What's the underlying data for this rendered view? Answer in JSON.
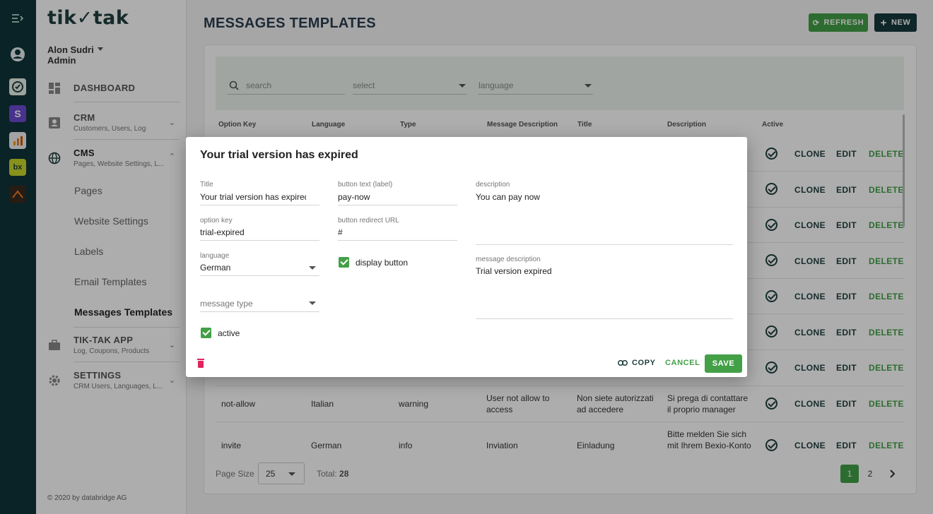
{
  "brand": {
    "logo_text": "tik✓tak"
  },
  "user": {
    "name": "Alon Sudri",
    "role": "Admin"
  },
  "nav": {
    "dashboard": "DASHBOARD",
    "crm": {
      "label": "CRM",
      "sub": "Customers, Users, Log"
    },
    "cms": {
      "label": "CMS",
      "sub": "Pages, Website Settings, L...",
      "items": [
        "Pages",
        "Website Settings",
        "Labels",
        "Email Templates",
        "Messages Templates"
      ]
    },
    "app": {
      "label": "TIK-TAK APP",
      "sub": "Log, Coupons, Products"
    },
    "settings": {
      "label": "SETTINGS",
      "sub": "CRM Users, Languages, L..."
    }
  },
  "footer": "© 2020 by databridge AG",
  "page": {
    "title": "MESSAGES TEMPLATES",
    "refresh": "REFRESH",
    "new": "NEW"
  },
  "filters": {
    "search": "search",
    "select": "select",
    "language": "language"
  },
  "table": {
    "headers": [
      "Option Key",
      "Language",
      "Type",
      "Message Description",
      "Title",
      "Description",
      "Active"
    ],
    "actions": {
      "clone": "CLONE",
      "edit": "EDIT",
      "delete": "DELETE"
    },
    "rows": [
      {
        "key": "not-allow",
        "language": "Italian",
        "type": "warning",
        "msg_desc_1": "User not allow to",
        "msg_desc_2": "access",
        "title_1": "Non siete autorizzati",
        "title_2": "ad accedere",
        "desc_1": "Si prega di contattare",
        "desc_2": "il proprio manager"
      },
      {
        "key": "invite",
        "language": "German",
        "type": "info",
        "msg_desc_1": "Inviation",
        "title_1": "Einladung",
        "desc_1": "Bitte melden Sie sich",
        "desc_2": "mit Ihrem Bexio-Konto"
      }
    ]
  },
  "pagination": {
    "page_size_label": "Page Size",
    "page_size": "25",
    "total_label": "Total:",
    "total": "28",
    "pages": [
      "1",
      "2"
    ]
  },
  "modal": {
    "title": "Your trial version has expired",
    "fields": {
      "title_label": "Title",
      "title_value": "Your trial version has expired",
      "button_text_label": "button text (label)",
      "button_text_value": "pay-now",
      "description_label": "description",
      "description_value": "You can pay now",
      "option_key_label": "option key",
      "option_key_value": "trial-expired",
      "button_url_label": "button redirect URL",
      "button_url_value": "#",
      "language_label": "language",
      "language_value": "German",
      "display_button_label": "display button",
      "message_description_label": "message description",
      "message_description_value": "Trial version expired",
      "message_type_placeholder": "message type",
      "active_label": "active"
    },
    "buttons": {
      "copy": "COPY",
      "cancel": "CANCEL",
      "save": "SAVE"
    }
  },
  "colors": {
    "accent": "#43a047",
    "dark": "#17383d",
    "delete_icon": "#e0245e"
  }
}
